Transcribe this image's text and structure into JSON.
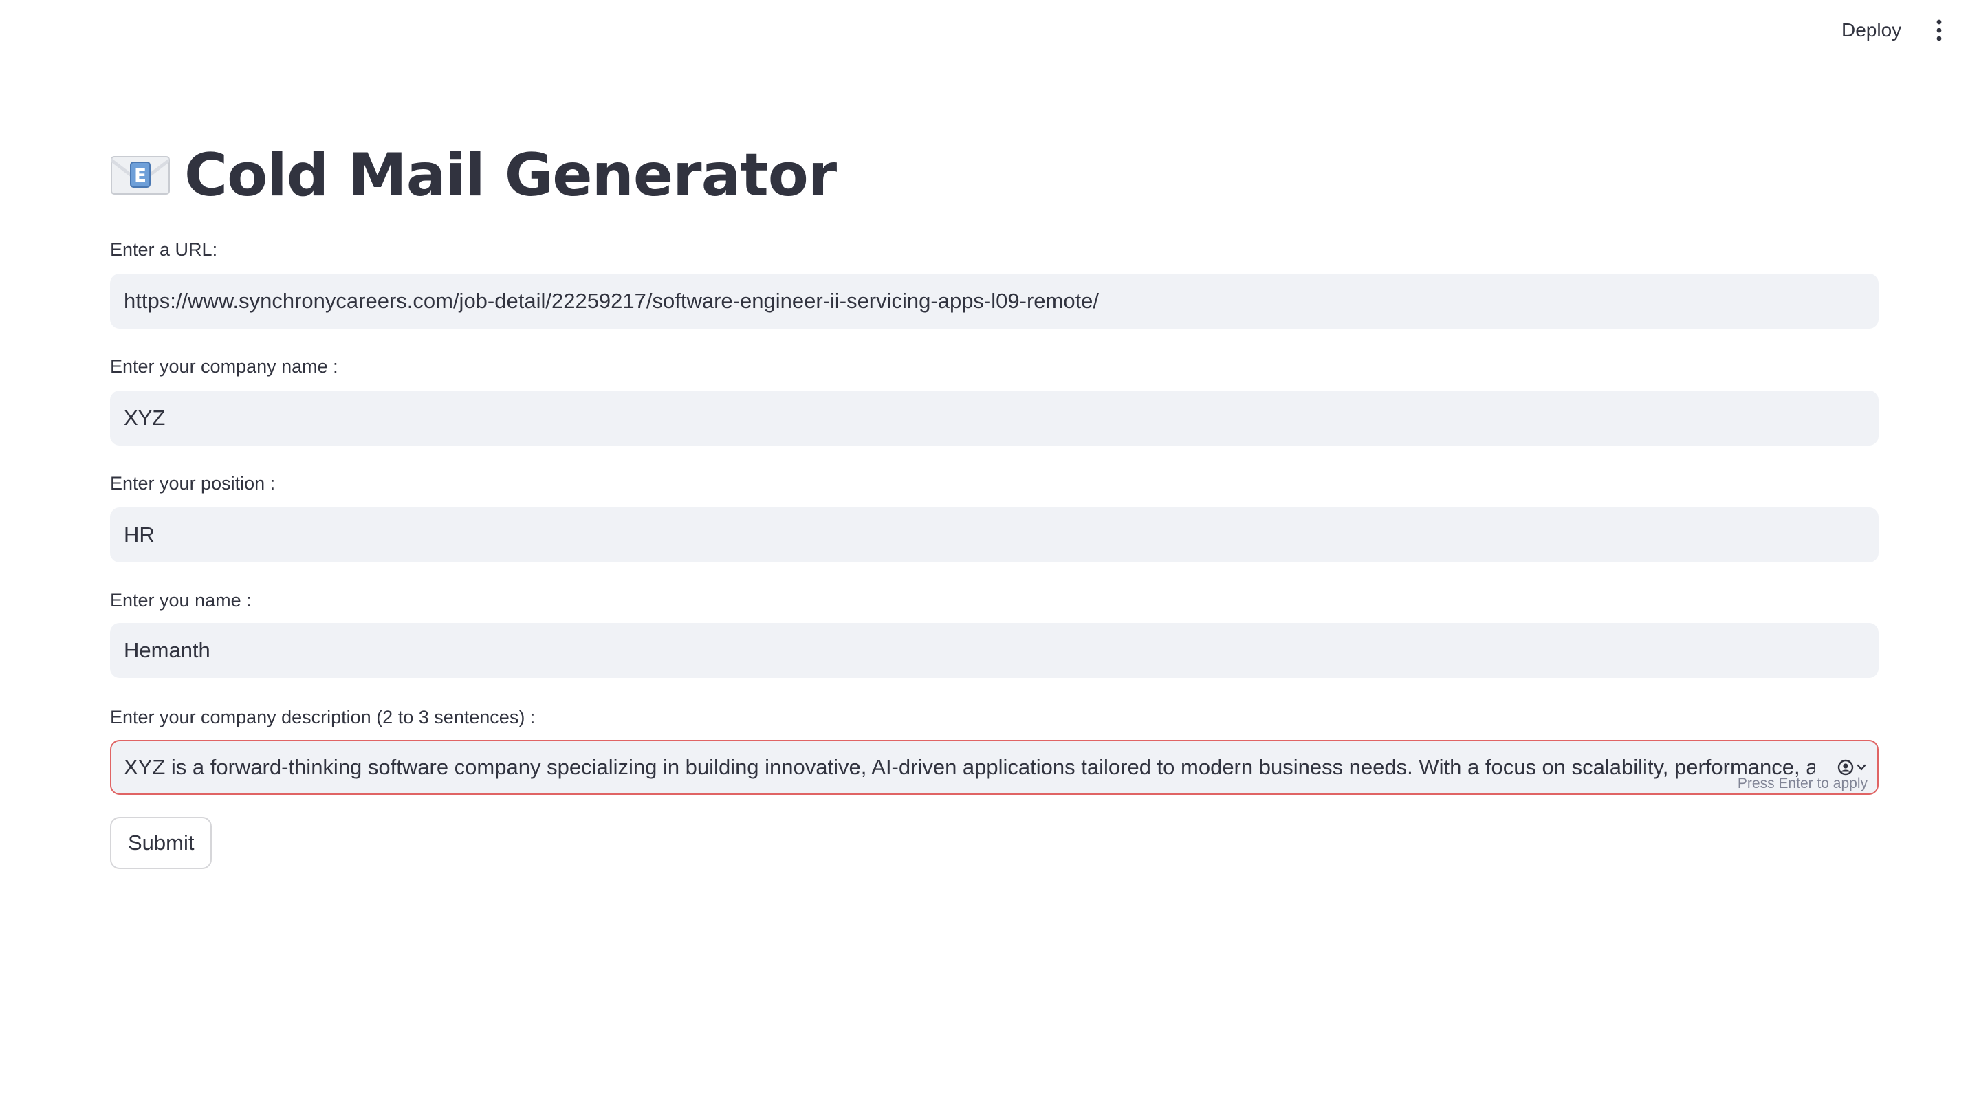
{
  "header": {
    "deploy_label": "Deploy",
    "menu_icon": "vertical-ellipsis-icon"
  },
  "main": {
    "title_icon": "envelope-with-e-emoji",
    "title": "Cold Mail Generator",
    "fields": [
      {
        "label": "Enter a URL:",
        "value": "https://www.synchronycareers.com/job-detail/22259217/software-engineer-ii-servicing-apps-l09-remote/"
      },
      {
        "label": "Enter your company name :",
        "value": "XYZ"
      },
      {
        "label": "Enter your position :",
        "value": "HR"
      },
      {
        "label": "Enter you name :",
        "value": "Hemanth"
      },
      {
        "label": "Enter your company description (2 to 3 sentences) :",
        "value": "XYZ is a forward-thinking software company specializing in building innovative, AI-driven applications tailored to modern business needs. With a focus on scalability, performance, and use",
        "hint": "Press Enter to apply",
        "state": "focused",
        "accent_color": "#e06464"
      }
    ],
    "submit_label": "Submit"
  },
  "colors": {
    "text": "#31333f",
    "input_bg": "#f0f2f6",
    "focus_border": "#e06464",
    "hint": "#808495"
  }
}
